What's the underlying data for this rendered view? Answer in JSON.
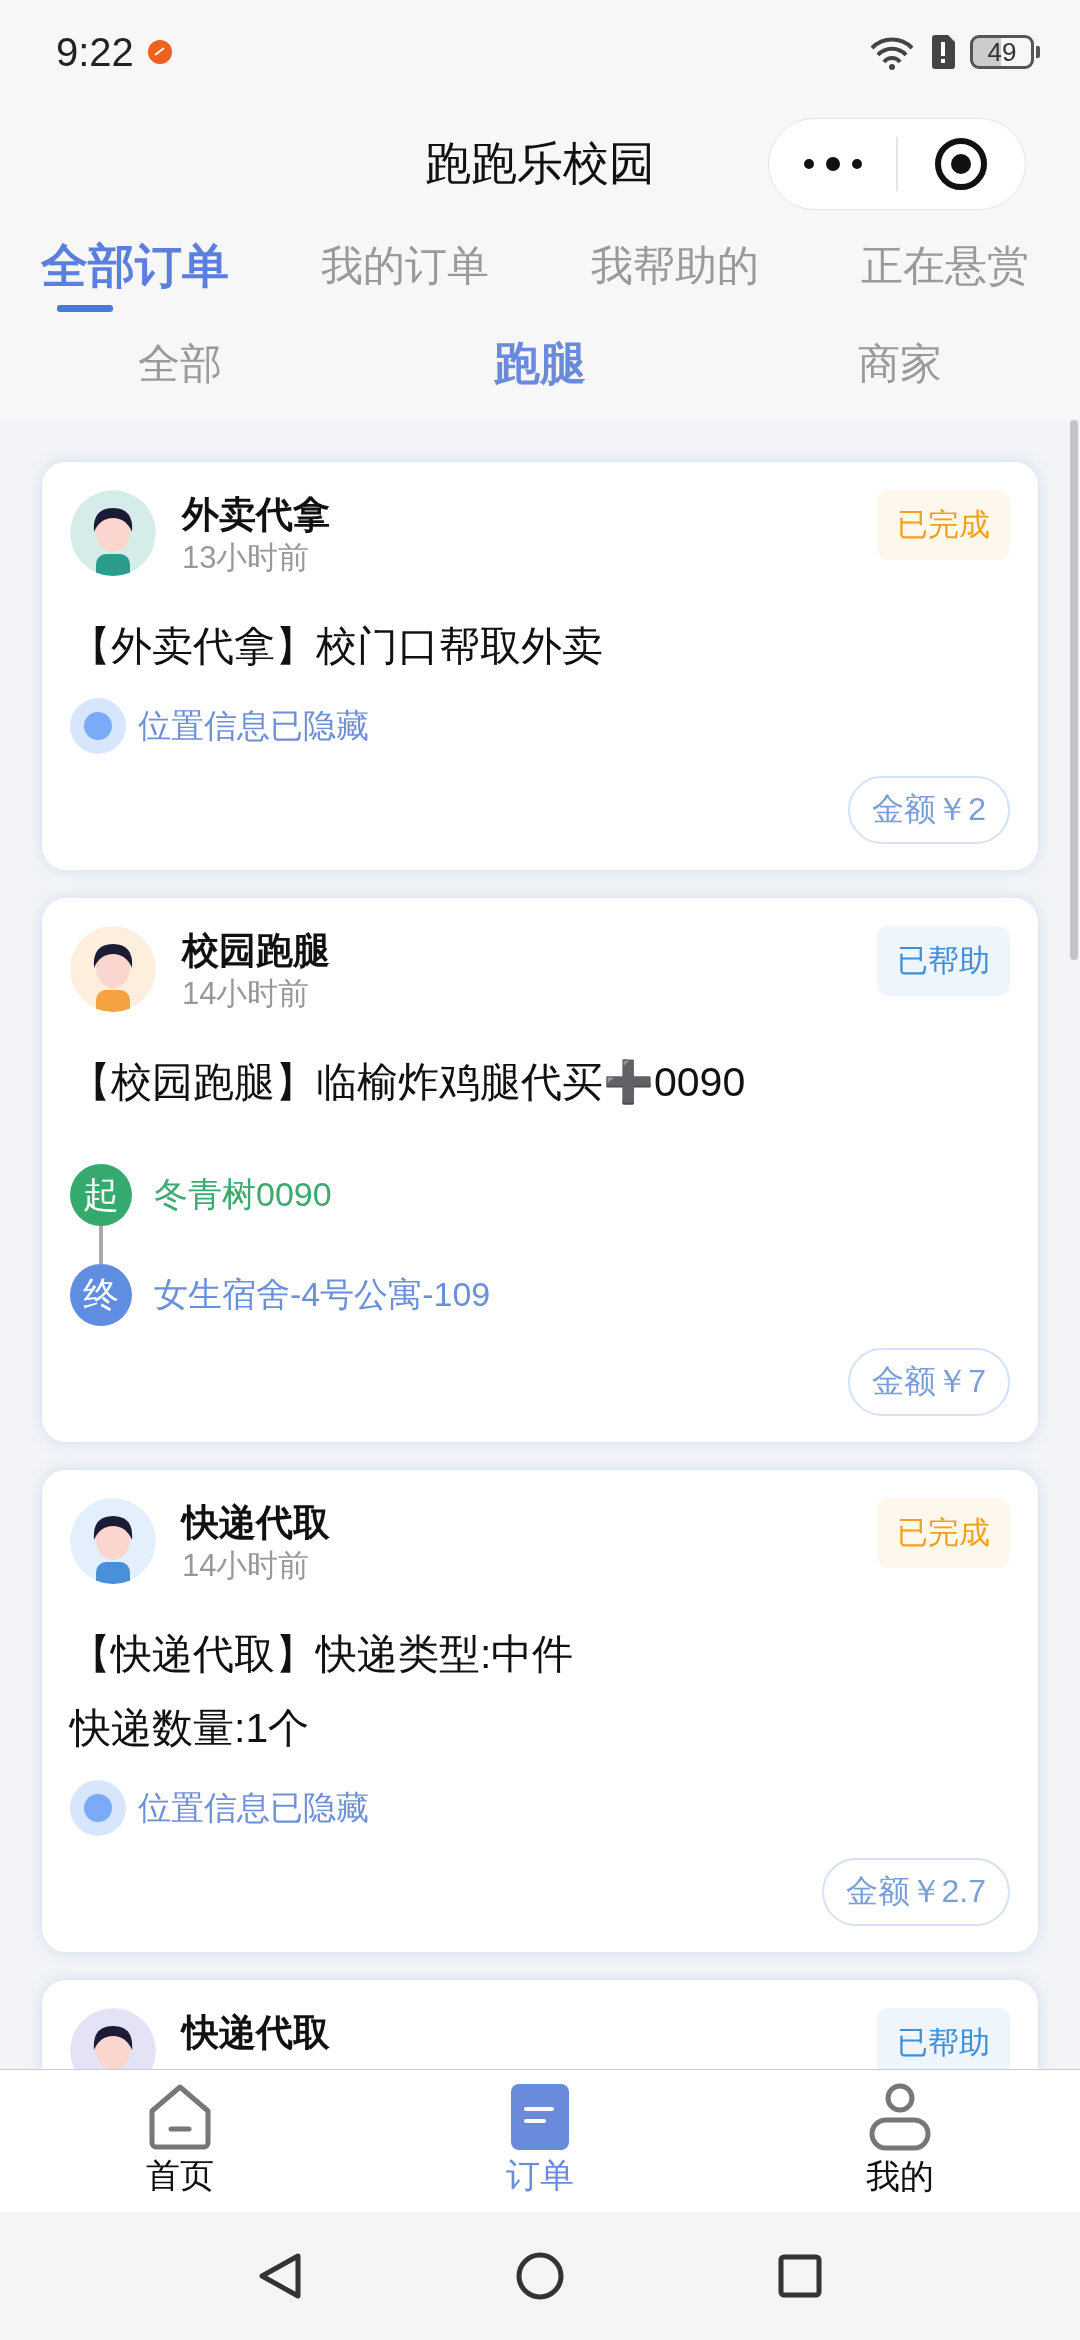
{
  "status_bar": {
    "time": "9:22",
    "battery": "49"
  },
  "header": {
    "title": "跑跑乐校园"
  },
  "tabs": [
    {
      "label": "全部订单",
      "selected": true
    },
    {
      "label": "我的订单",
      "selected": false
    },
    {
      "label": "我帮助的",
      "selected": false
    },
    {
      "label": "正在悬赏",
      "selected": false
    }
  ],
  "subtabs": [
    {
      "label": "全部",
      "selected": false
    },
    {
      "label": "跑腿",
      "selected": true
    },
    {
      "label": "商家",
      "selected": false
    }
  ],
  "orders": [
    {
      "kind": "hidden",
      "title": "外卖代拿",
      "time": "13小时前",
      "status": "已完成",
      "color": "#f0a020",
      "description": [
        "【外卖代拿】校门口帮取外卖"
      ],
      "location": "位置信息已隐藏",
      "amount": "金额￥2"
    },
    {
      "kind": "route",
      "title": "校园跑腿",
      "time": "14小时前",
      "status": "已帮助",
      "color": "#3f8fd8",
      "description": [
        "【校园跑腿】临榆炸鸡腿代买➕0090"
      ],
      "route": {
        "start_mark": "起",
        "start": "冬青树0090",
        "end_mark": "终",
        "end": "女生宿舍-4号公寓-109"
      },
      "amount": "金额￥7"
    },
    {
      "kind": "hidden",
      "title": "快递代取",
      "time": "14小时前",
      "status": "已完成",
      "color": "#f0a020",
      "description": [
        "【快递代取】快递类型:中件",
        "快递数量:1个"
      ],
      "location": "位置信息已隐藏",
      "amount": "金额￥2.7"
    },
    {
      "kind": "header_only",
      "title": "快递代取",
      "status": "已帮助",
      "color": "#3f8fd8"
    }
  ],
  "bottom_nav": [
    {
      "label": "首页",
      "selected": false
    },
    {
      "label": "订单",
      "selected": true
    },
    {
      "label": "我的",
      "selected": false
    }
  ]
}
